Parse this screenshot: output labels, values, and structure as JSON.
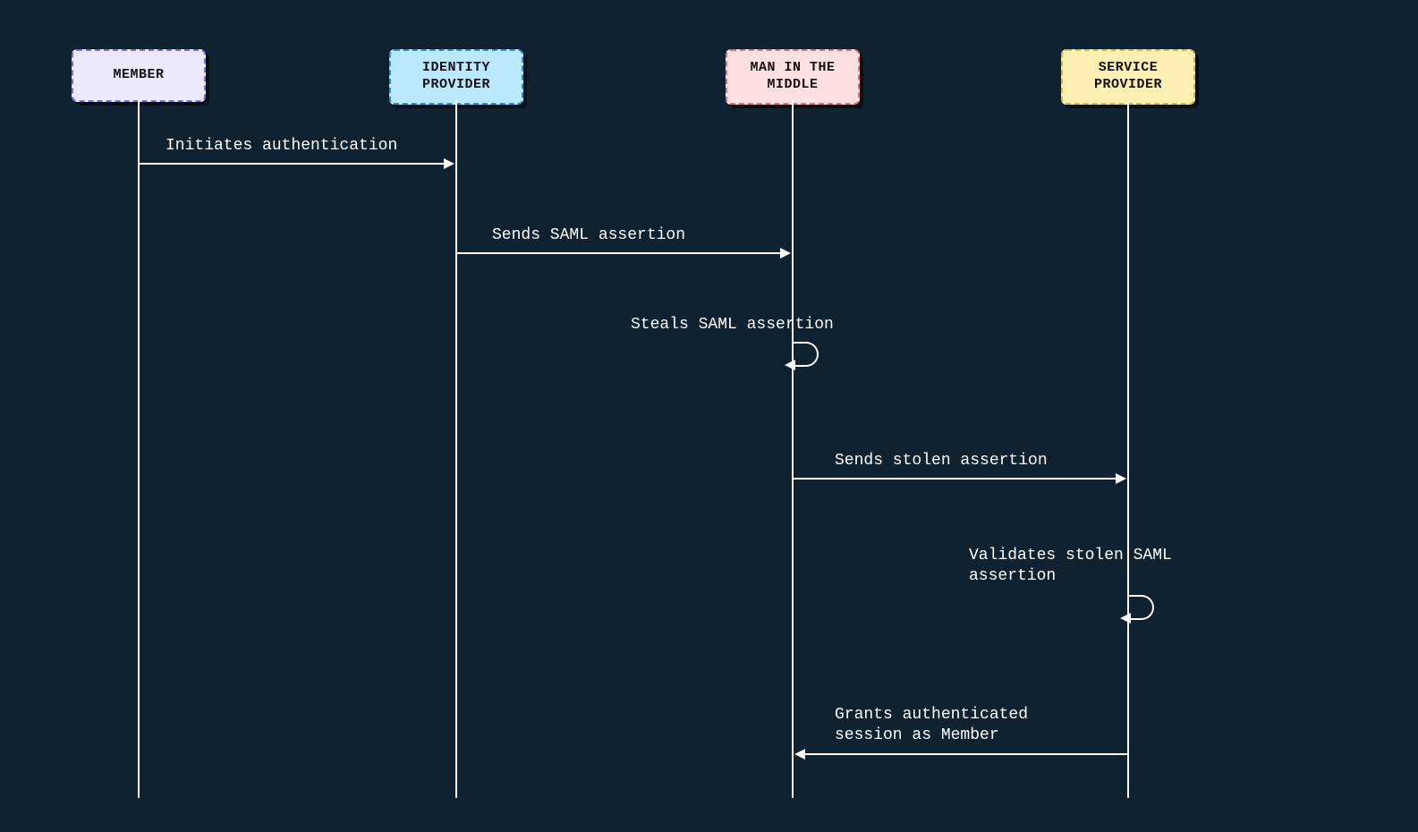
{
  "actors": {
    "member": "MEMBER",
    "idp": "IDENTITY\nPROVIDER",
    "mitm": "MAN IN THE\nMIDDLE",
    "sp": "SERVICE\nPROVIDER"
  },
  "messages": {
    "m1": "Initiates authentication",
    "m2": "Sends SAML assertion",
    "m3": "Steals SAML assertion",
    "m4": "Sends stolen assertion",
    "m5": "Validates stolen SAML\nassertion",
    "m6": "Grants authenticated\nsession as Member"
  },
  "chart_data": {
    "type": "sequence-diagram",
    "actors": [
      "Member",
      "Identity Provider",
      "Man in the Middle",
      "Service Provider"
    ],
    "messages": [
      {
        "from": "Member",
        "to": "Identity Provider",
        "label": "Initiates authentication"
      },
      {
        "from": "Identity Provider",
        "to": "Man in the Middle",
        "label": "Sends SAML assertion"
      },
      {
        "from": "Man in the Middle",
        "to": "Man in the Middle",
        "label": "Steals SAML assertion"
      },
      {
        "from": "Man in the Middle",
        "to": "Service Provider",
        "label": "Sends stolen assertion"
      },
      {
        "from": "Service Provider",
        "to": "Service Provider",
        "label": "Validates stolen SAML assertion"
      },
      {
        "from": "Service Provider",
        "to": "Man in the Middle",
        "label": "Grants authenticated session as Member"
      }
    ]
  }
}
